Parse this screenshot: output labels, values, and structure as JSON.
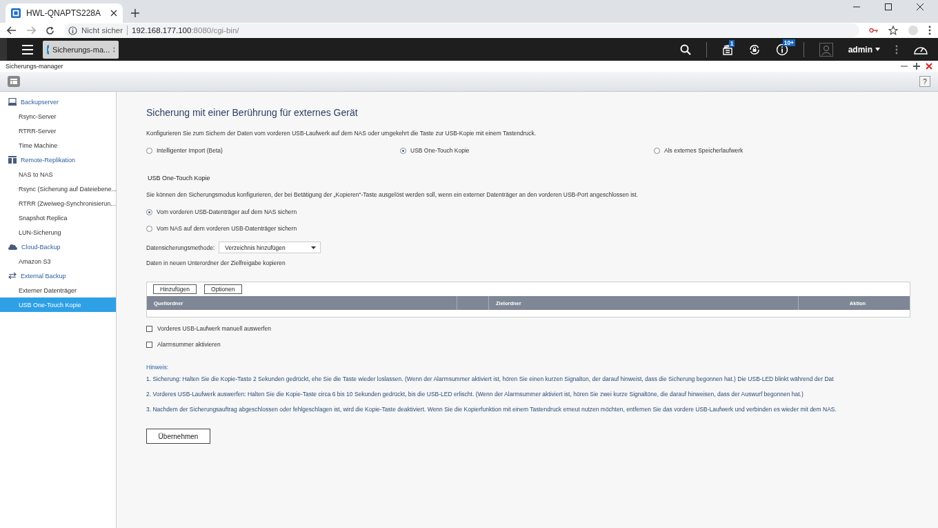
{
  "browser": {
    "tab_title": "HWL-QNAPTS228A",
    "security": "Nicht sicher",
    "url_host": "192.168.177.100",
    "url_rest": ":8080/cgi-bin/"
  },
  "app_bar": {
    "app_tab": "Sicherungs-ma...",
    "notification_badge": "1",
    "info_badge": "10+",
    "user": "admin"
  },
  "window": {
    "title": "Sicherungs-manager",
    "help": "?"
  },
  "sidebar": {
    "groups": [
      {
        "label": "Backupserver",
        "children": [
          {
            "label": "Rsync-Server",
            "selected": false
          },
          {
            "label": "RTRR-Server",
            "selected": false
          },
          {
            "label": "Time Machine",
            "selected": false
          }
        ]
      },
      {
        "label": "Remote-Replikation",
        "children": [
          {
            "label": "NAS to NAS",
            "selected": false
          },
          {
            "label": "Rsync (Sicherung auf Dateiebene...",
            "selected": false
          },
          {
            "label": "RTRR (Zweiweg-Synchronisierun...",
            "selected": false
          },
          {
            "label": "Snapshot Replica",
            "selected": false
          },
          {
            "label": "LUN-Sicherung",
            "selected": false
          }
        ]
      },
      {
        "label": "Cloud-Backup",
        "children": [
          {
            "label": "Amazon S3",
            "selected": false
          }
        ]
      },
      {
        "label": "External Backup",
        "children": [
          {
            "label": "Externer Datenträger",
            "selected": false
          },
          {
            "label": "USB One-Touch Kopie",
            "selected": true
          }
        ]
      }
    ]
  },
  "content": {
    "title": "Sicherung mit einer Berührung für externes Gerät",
    "intro": "Konfigurieren Sie zum Sichern der Daten vom vorderen USB-Laufwerk auf dem NAS oder umgekehrt die Taste zur USB-Kopie mit einem Tastendruck.",
    "modes": [
      {
        "label": "Intelligenter Import (Beta)",
        "selected": false
      },
      {
        "label": "USB One-Touch Kopie",
        "selected": true
      },
      {
        "label": "Als externes Speicherlaufwerk",
        "selected": false
      }
    ],
    "section_title": "USB One-Touch Kopie",
    "section_text": "Sie können den Sicherungsmodus konfigurieren, der bei Betätigung der „Kopieren“-Taste ausgelöst werden soll, wenn ein externer Datenträger an den vorderen USB-Port angeschlossen ist.",
    "directions": [
      {
        "label": "Vom vorderen USB-Datenträger auf dem NAS sichern",
        "selected": true
      },
      {
        "label": "Vom NAS auf dem vorderen USB-Datenträger sichern",
        "selected": false
      }
    ],
    "method_label": "Datensicherungsmethode:",
    "method_value": "Verzeichnis hinzufügen",
    "method_note": "Daten in neuen Unterordner der Zielfreigabe kopieren",
    "table_buttons": [
      "Hinzufügen",
      "Optionen"
    ],
    "table_columns": [
      "Quellordner",
      "",
      "Zielordner",
      "Aktion"
    ],
    "checkboxes": [
      {
        "label": "Vorderes USB-Laufwerk manuell auswerfen",
        "checked": false
      },
      {
        "label": "Alarmsummer aktivieren",
        "checked": false
      }
    ],
    "hint_title": "Hinweis:",
    "hints": [
      "1. Sicherung: Halten Sie die Kopie-Taste 2 Sekunden gedrückt, ehe Sie die Taste wieder loslassen. (Wenn der Alarmsummer aktiviert ist, hören Sie einen kurzen Signalton, der darauf hinweist, dass die Sicherung begonnen hat.) Die USB-LED blinkt während der Dat",
      "2. Vorderes USB-Laufwerk auswerfen: Halten Sie die Kopie-Taste circa 6 bis 10 Sekunden gedrückt, bis die USB-LED erlischt. (Wenn der Alarmsummer aktiviert ist, hören Sie zwei kurze Signaltöne, die darauf hinweisen, dass der Auswurf begonnen hat.)",
      "3. Nachdem der Sicherungsauftrag abgeschlossen oder fehlgeschlagen ist, wird die Kopie-Taste deaktiviert. Wenn Sie die Kopierfunktion mit einem Tastendruck erneut nutzen möchten, entfernen Sie das vordere USB-Laufwerk und verbinden es wieder mit dem NAS."
    ],
    "apply_button": "Übernehmen"
  }
}
